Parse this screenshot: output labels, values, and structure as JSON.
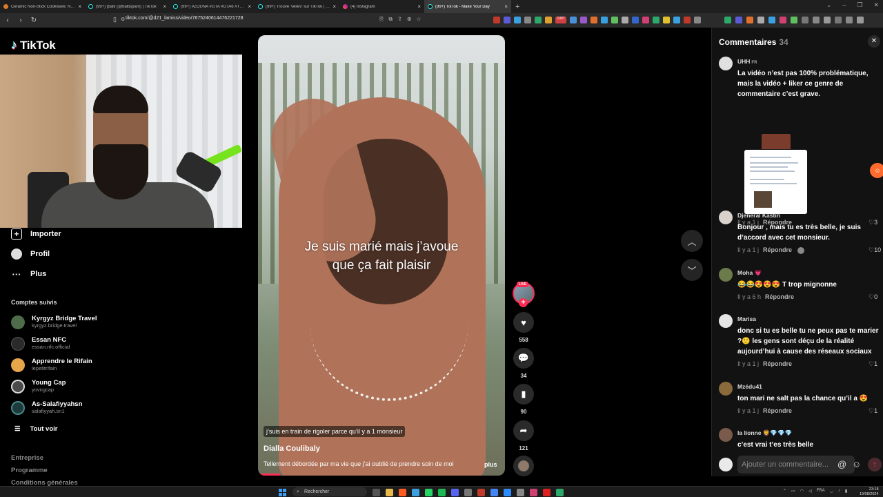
{
  "browser": {
    "tabs": [
      {
        "title": "Ceramic Non-Stick Cookware: Non-T",
        "icon": "cookware-favicon",
        "active": false
      },
      {
        "title": "(99+) |balti (@baltispam) | TikTok",
        "icon": "tiktok-favicon",
        "active": false
      },
      {
        "title": "(99+) #ZOUNA #GTA #GTA6 #TRAILE",
        "icon": "tiktok-favicon",
        "active": false
      },
      {
        "title": "(99+) Trouve 'veliev' sur TikTok | Rec",
        "icon": "tiktok-favicon",
        "active": false
      },
      {
        "title": "(4) Instagram",
        "icon": "instagram-favicon",
        "active": false
      },
      {
        "title": "(99+) TikTok - Make Your Day",
        "icon": "tiktok-favicon",
        "active": true
      }
    ],
    "new_tab": "+",
    "url": "tiktok.com/@d21_lamiss/video/7675240614476221728",
    "ext_badge": "1097"
  },
  "sidebar": {
    "logo": "TikTok",
    "nav": [
      {
        "label": "Importer",
        "icon": "upload-plus-icon"
      },
      {
        "label": "Profil",
        "icon": "profile-avatar-icon"
      },
      {
        "label": "Plus",
        "icon": "more-dots-icon"
      }
    ],
    "following_title": "Comptes suivis",
    "accounts": [
      {
        "name": "Kyrgyz Bridge Travel",
        "handle": "kyrgyz.bridge.travel",
        "color": "#4e6b4a"
      },
      {
        "name": "Essan NFC",
        "handle": "essan.nfc.official",
        "color": "#2a2a2a"
      },
      {
        "name": "Apprendre le Rifain",
        "handle": "lepetitrifain",
        "color": "#e8a64a"
      },
      {
        "name": "Young Cap",
        "handle": "yovngcap",
        "color": "#4a4a4a"
      },
      {
        "name": "As-Salafiyyahsn",
        "handle": "salafiyyah.sn1",
        "color": "#1c3b3d"
      }
    ],
    "see_all": "Tout voir",
    "footer": [
      "Entreprise",
      "Programme",
      "Conditions générales"
    ]
  },
  "video": {
    "caption_line1": "Je suis marié mais j’avoue",
    "caption_line2": "que ça fait plaisir",
    "subtitle": "j’suis en train de rigoler parce qu’il y a 1 monsieur",
    "author": "Dialla Coulibaly",
    "description": "Tellement débordée par ma vie que j’ai oublié de prendre soin de moi",
    "more": "plus",
    "progress_fraction": 0.09,
    "live_label": "LIVE",
    "likes": "558",
    "comments": "34",
    "saves": "90",
    "shares": "121"
  },
  "comments": {
    "title": "Commentaires",
    "count": "34",
    "input_placeholder": "Ajouter un commentaire...",
    "reply_label": "Répondre",
    "items": [
      {
        "user": "UHH",
        "flag": "FR",
        "text": "La vidéo n’est pas 100% problématique, mais la vidéo + liker ce genre de commentaire c’est grave.",
        "time": "Il y a 1 j",
        "likes": "3",
        "avatar": "#e0e0e0",
        "has_image": true
      },
      {
        "user": "Djeneral Kastiri",
        "flag": "",
        "text": "Bonjour , mais tu es très belle, je suis d’accord avec cet monsieur.",
        "time": "Il y a 1 j",
        "likes": "10",
        "avatar": "#d9d2cc"
      },
      {
        "user": "Moha 💗",
        "flag": "",
        "text": "😂😂😍😍😍 T trop mignonne",
        "time": "Il y a 6 h",
        "likes": "0",
        "avatar": "#6b7b4a"
      },
      {
        "user": "Marisa",
        "flag": "",
        "text": "donc si tu es belle tu ne peux pas te marier ?🙂 les gens sont déçu de la réalité aujourd’hui à cause des réseaux sociaux",
        "time": "Il y a 1 j",
        "likes": "1",
        "avatar": "#e6e6e6"
      },
      {
        "user": "Mzédu41",
        "flag": "",
        "text": "ton mari ne salt pas la chance qu’il a 😍",
        "time": "Il y a 1 j",
        "likes": "1",
        "avatar": "#8a6a3a"
      },
      {
        "user": "la lionne 🦁💎💎💎",
        "flag": "",
        "text": "c’est vrai t’es très belle",
        "time": "",
        "likes": "",
        "avatar": "#7a5a4a"
      }
    ]
  },
  "taskbar": {
    "search_placeholder": "Rechercher",
    "lang": "FRA",
    "time": "23:18",
    "date": "19/08/2024"
  }
}
